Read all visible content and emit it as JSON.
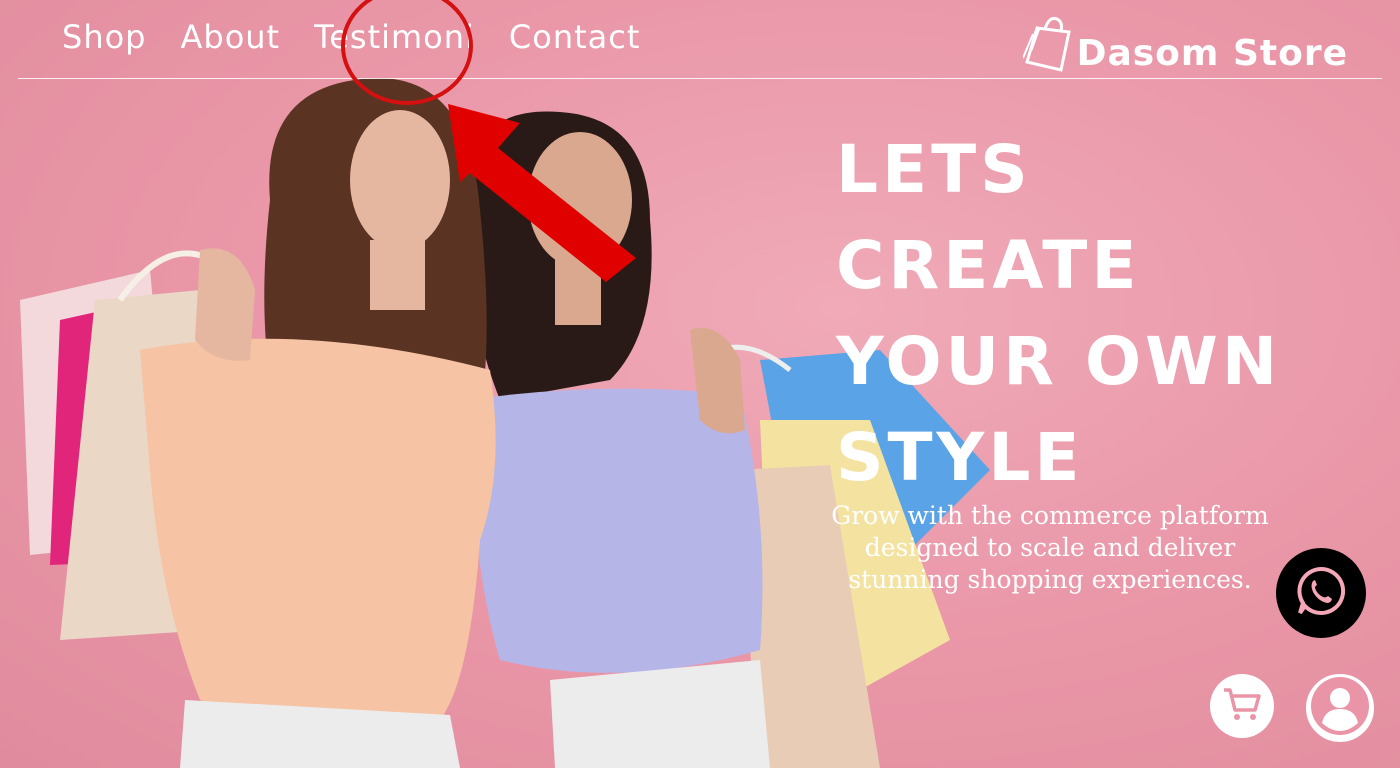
{
  "nav": {
    "items": [
      {
        "label": "Shop"
      },
      {
        "label": "About"
      },
      {
        "label": "Testimoni"
      },
      {
        "label": "Contact"
      }
    ]
  },
  "brand": {
    "name": "Dasom Store",
    "icon": "shopping-bag-icon"
  },
  "hero": {
    "headline_lines": [
      "LETS",
      "CREATE",
      "YOUR OWN",
      "STYLE"
    ],
    "tagline_lines": [
      "Grow with the commerce platform",
      "designed to scale and deliver",
      "stunning shopping experiences."
    ]
  },
  "actions": {
    "whatsapp_icon": "whatsapp-icon",
    "cart_icon": "cart-icon",
    "user_icon": "user-icon"
  },
  "colors": {
    "background": "#ec9fae",
    "text": "#ffffff",
    "annotation": "#e00000",
    "whatsapp_bg": "#000000"
  }
}
